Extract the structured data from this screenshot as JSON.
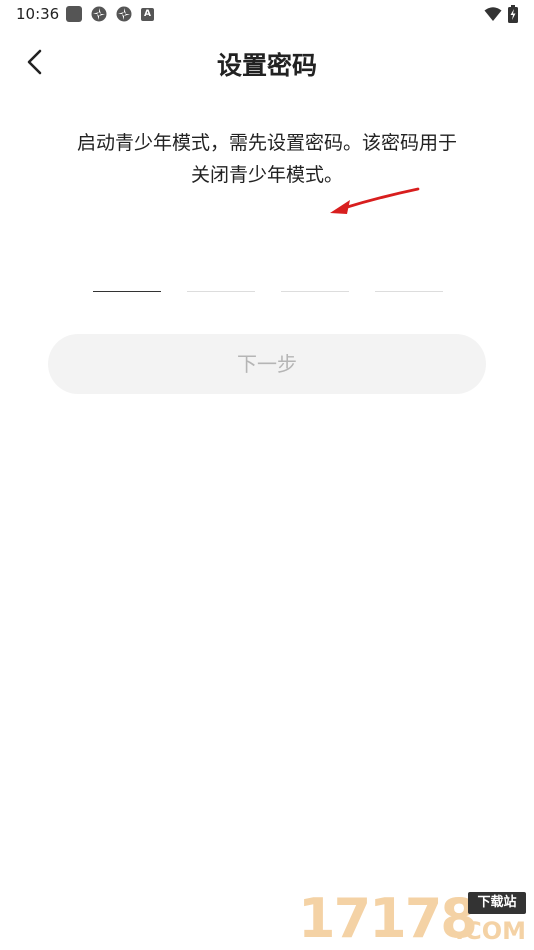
{
  "status_bar": {
    "time": "10:36",
    "notification_icons": [
      "square-icon",
      "pinwheel-icon",
      "pinwheel-icon",
      "a-icon"
    ],
    "a_icon_label": "A",
    "right_icons": [
      "wifi-icon",
      "battery-charging-icon"
    ]
  },
  "header": {
    "back_icon": "chevron-left-icon",
    "title": "设置密码"
  },
  "description": {
    "line1": "启动青少年模式，需先设置密码。该密码用于",
    "line2": "关闭青少年模式。"
  },
  "pin": {
    "length": 4,
    "values": [
      "",
      "",
      "",
      ""
    ]
  },
  "next_button": {
    "label": "下一步",
    "enabled": false
  },
  "watermark": {
    "digits": "17178",
    "badge": "下载站",
    "suffix": ".COM"
  },
  "colors": {
    "background": "#ffffff",
    "text": "#222222",
    "button_bg": "#f3f3f3",
    "button_text": "#b5b5b5",
    "annotation_arrow": "#d81e1e",
    "watermark": "#f4d2a5"
  }
}
